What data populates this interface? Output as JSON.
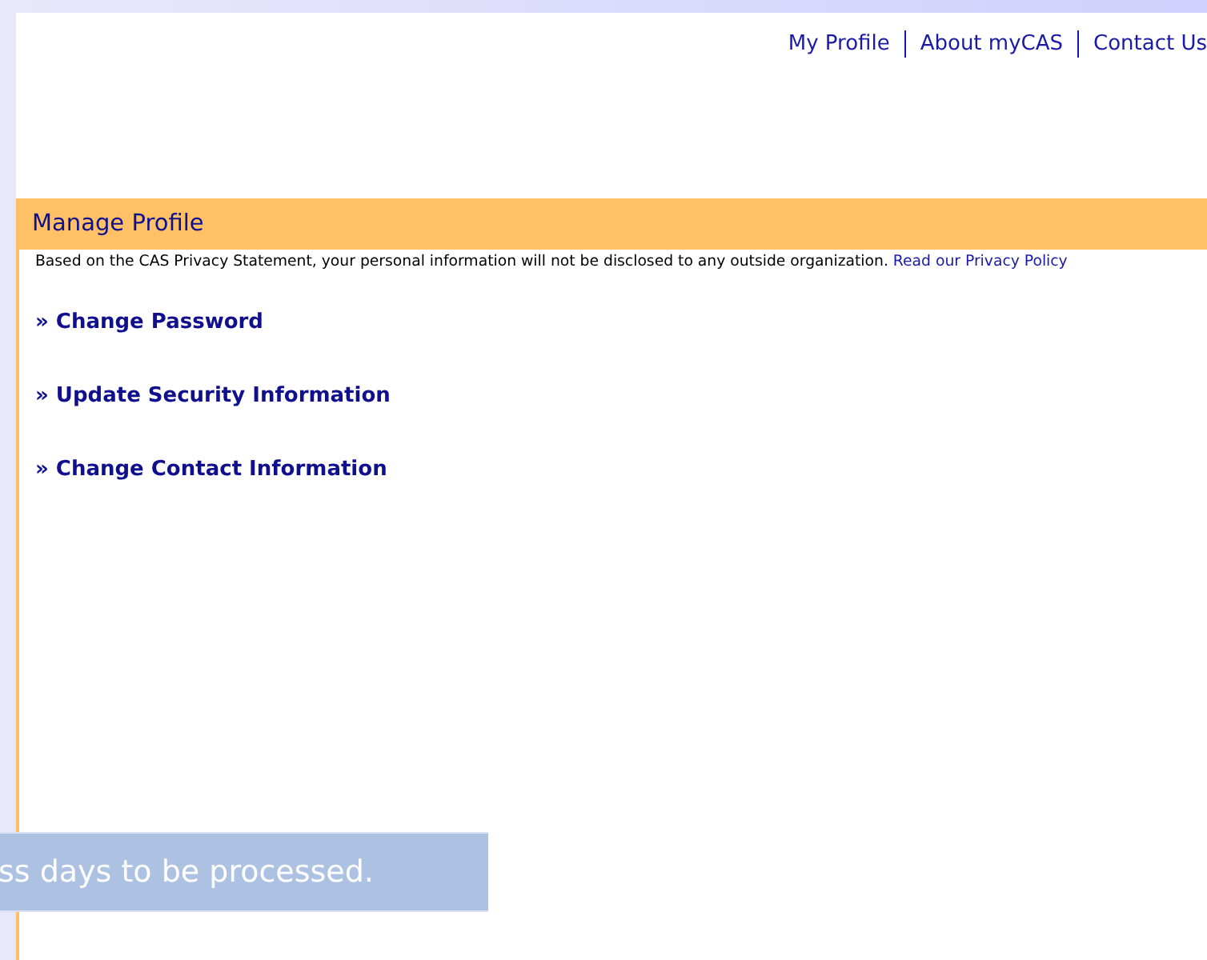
{
  "top_links": [
    "My Profile",
    "About myCAS",
    "Contact Us"
  ],
  "section": {
    "title": "Manage Profile",
    "notice": "Based on the CAS Privacy Statement, your personal information will not be disclosed to any outside organization.",
    "notice_link": "Read our Privacy Policy"
  },
  "links": [
    "» Change Password",
    "» Update Security Information",
    "» Change Contact Information"
  ],
  "overlay_banner": "ss days to be processed."
}
